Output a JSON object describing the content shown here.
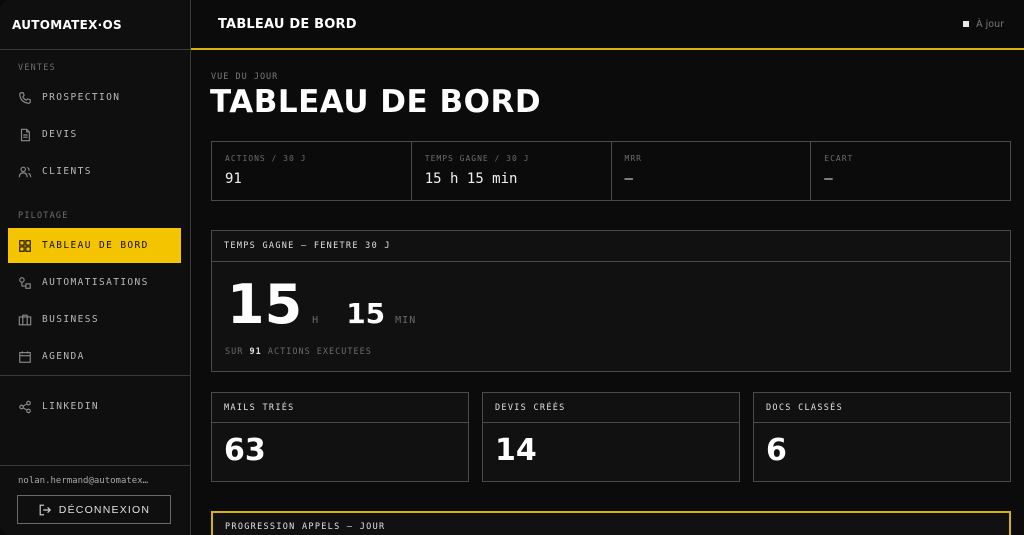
{
  "brand": "AUTOMATEX·OS",
  "sidebar": {
    "sections": [
      {
        "label": "VENTES"
      },
      {
        "label": "PILOTAGE"
      }
    ],
    "items": [
      {
        "label": "PROSPECTION",
        "icon": "phone-icon"
      },
      {
        "label": "DEVIS",
        "icon": "document-icon"
      },
      {
        "label": "CLIENTS",
        "icon": "users-icon"
      },
      {
        "label": "TABLEAU DE BORD",
        "icon": "grid-icon",
        "active": true
      },
      {
        "label": "AUTOMATISATIONS",
        "icon": "workflow-icon"
      },
      {
        "label": "BUSINESS",
        "icon": "briefcase-icon"
      },
      {
        "label": "AGENDA",
        "icon": "calendar-icon"
      },
      {
        "label": "LINKEDIN",
        "icon": "share-icon"
      }
    ],
    "user_email": "nolan.hermand@automatex…",
    "logout_label": "DÉCONNEXION"
  },
  "topbar": {
    "title": "TABLEAU DE BORD",
    "status": "À jour"
  },
  "header": {
    "overline": "VUE DU JOUR",
    "title": "TABLEAU DE BORD"
  },
  "kpis": [
    {
      "label": "ACTIONS / 30 J",
      "value": "91"
    },
    {
      "label": "TEMPS GAGNE / 30 J",
      "value": "15 h 15 min"
    },
    {
      "label": "MRR",
      "value": "—"
    },
    {
      "label": "ECART",
      "value": "—"
    }
  ],
  "time_saved": {
    "title": "TEMPS GAGNE — FENETRE 30 J",
    "hours": "15",
    "hours_unit": "H",
    "minutes": "15",
    "minutes_unit": "MIN",
    "sub_prefix": "SUR",
    "sub_count": "91",
    "sub_suffix": "ACTIONS EXECUTEES"
  },
  "stats": [
    {
      "label": "MAILS TRIÉS",
      "value": "63"
    },
    {
      "label": "DEVIS CRÉÉS",
      "value": "14"
    },
    {
      "label": "DOCS CLASSÉS",
      "value": "6"
    }
  ],
  "progress": {
    "title": "PROGRESSION APPELS — JOUR"
  },
  "colors": {
    "accent": "#f5c400",
    "background": "#0b0b0b",
    "border": "#4a4a4a"
  }
}
